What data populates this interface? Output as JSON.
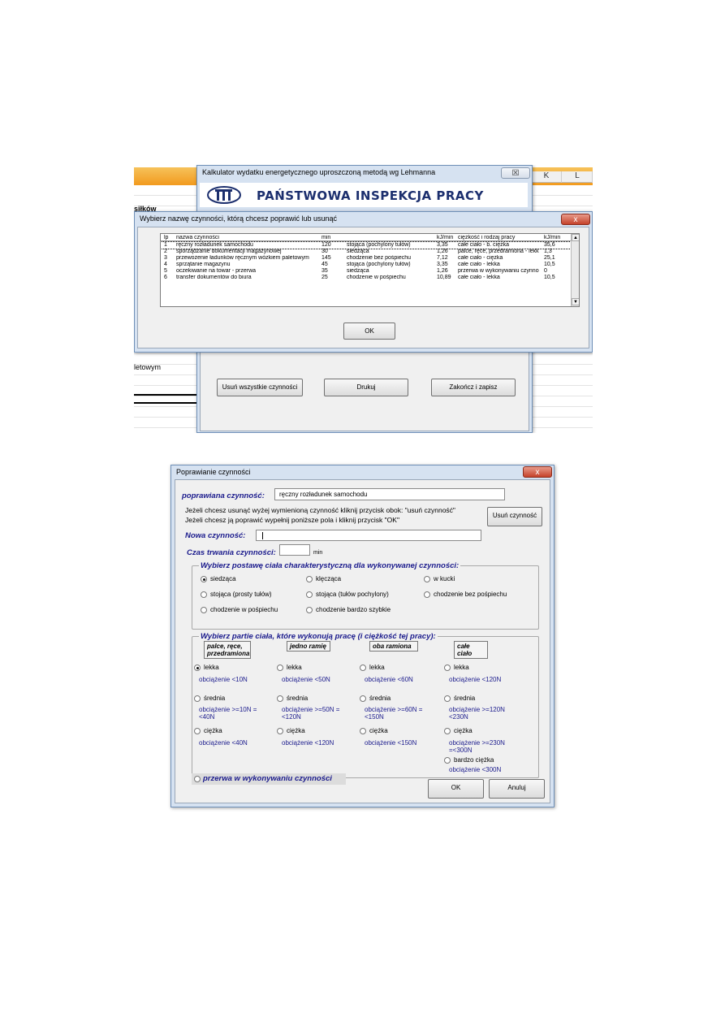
{
  "shot1": {
    "excel": {
      "col_k": "K",
      "col_l": "L",
      "cell_fragment_1": "siłków",
      "cell_fragment_2": "letowym"
    },
    "main_window": {
      "title": "Kalkulator wydatku energetycznego uproszczoną metodą wg Lehmanna",
      "close_glyph": "☒",
      "logo_text": "PAŃSTWOWA INSPEKCJA PRACY",
      "buttons": {
        "clear_all": "Usuń wszystkie czynności",
        "print": "Drukuj",
        "finish": "Zakończ i zapisz"
      }
    },
    "select_dialog": {
      "title": "Wybierz nazwę czynności, którą chcesz poprawić lub usunąć",
      "close_glyph": "x",
      "ok": "OK",
      "headers": [
        "lp",
        "nazwa czynności",
        "min",
        "",
        "kJ/min",
        "ciężkość i rodzaj pracy",
        "kJ/min"
      ],
      "rows": [
        [
          "1",
          "ręczny rozładunek samochodu",
          "120",
          "stojąca (pochylony tułów)",
          "3,35",
          "całe ciało - b. ciężka",
          "35,6"
        ],
        [
          "2",
          "sporządzanie dokumentacji magazynowej",
          "30",
          "siedząca",
          "1,26",
          "palce, ręce, przedramiona - lekk",
          "1,3"
        ],
        [
          "3",
          "przewożenie ładunków ręcznym wózkiem paletowym",
          "145",
          "chodzenie bez pośpiechu",
          "7,12",
          "całe ciało - ciężka",
          "25,1"
        ],
        [
          "4",
          "sprzątanie magazynu",
          "45",
          "stojąca (pochylony tułów)",
          "3,35",
          "całe ciało - lekka",
          "10,5"
        ],
        [
          "5",
          "oczekiwanie na towar - przerwa",
          "35",
          "siedząca",
          "1,26",
          "przerwa w wykonywaniu czynno",
          "0"
        ],
        [
          "6",
          "transfer dokumentów do biura",
          "25",
          "chodzenie w pośpiechu",
          "10,89",
          "całe ciało - lekka",
          "10,5"
        ]
      ]
    }
  },
  "shot2": {
    "title": "Poprawianie czynności",
    "close_glyph": "x",
    "edited_label": "poprawiana czynność:",
    "edited_value": "ręczny rozładunek samochodu",
    "info_line1": "Jeżeli chcesz usunąć wyżej wymienioną czynność kliknij przycisk obok:  \"usuń czynność\"",
    "info_line2": "Jeżeli chcesz ją poprawić wypełnij poniższe pola i kliknij przycisk \"OK\"",
    "delete_button": "Usuń czynność",
    "new_label": "Nowa czynność:",
    "new_value": "",
    "duration_label": "Czas trwania czynności:",
    "duration_value": "",
    "duration_unit": "min",
    "posture_caption": "Wybierz postawę ciała charakterystyczną dla wykonywanej czynności:",
    "postures": [
      {
        "label": "siedząca",
        "selected": true
      },
      {
        "label": "klęcząca",
        "selected": false
      },
      {
        "label": "w kucki",
        "selected": false
      },
      {
        "label": "stojąca (prosty tułów)",
        "selected": false
      },
      {
        "label": "stojąca (tułów pochylony)",
        "selected": false
      },
      {
        "label": "chodzenie bez pośpiechu",
        "selected": false
      },
      {
        "label": "chodzenie w pośpiechu",
        "selected": false
      },
      {
        "label": "chodzenie bardzo szybkie",
        "selected": false
      }
    ],
    "parts_caption": "Wybierz partie ciała, które wykonują pracę (i ciężkość tej pracy):",
    "groups": [
      {
        "head": "palce, ręce, przedramiona",
        "lekka": "lekka",
        "lekka_load": "obciążenie <10N",
        "srednia": "średnia",
        "srednia_load": "obciążenie >=10N  =<40N",
        "ciezka": "ciężka",
        "ciezka_load": "obciążenie <40N",
        "selected": "lekka"
      },
      {
        "head": "jedno ramię",
        "lekka": "lekka",
        "lekka_load": "obciążenie <50N",
        "srednia": "średnia",
        "srednia_load": "obciążenie >=50N  =<120N",
        "ciezka": "ciężka",
        "ciezka_load": "obciążenie <120N"
      },
      {
        "head": "oba ramiona",
        "lekka": "lekka",
        "lekka_load": "obciążenie <60N",
        "srednia": "średnia",
        "srednia_load": "obciążenie >=60N  =<150N",
        "ciezka": "ciężka",
        "ciezka_load": "obciążenie <150N"
      },
      {
        "head": "całe ciało",
        "lekka": "lekka",
        "lekka_load": "obciążenie <120N",
        "srednia": "średnia",
        "srednia_load": "obciążenie >=120N  <230N",
        "ciezka": "ciężka",
        "ciezka_load": "obciążenie >=230N  =<300N",
        "bardzo": "bardzo ciężka",
        "bardzo_load": "obciążenie <300N"
      }
    ],
    "break_label": "przerwa w wykonywaniu czynności",
    "ok": "OK",
    "cancel": "Anuluj"
  }
}
